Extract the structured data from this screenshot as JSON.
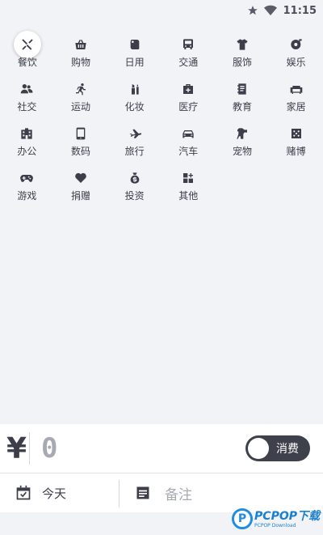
{
  "status_bar": {
    "icons": [
      "star-icon",
      "wifi-icon"
    ],
    "time": "11:15"
  },
  "categories": [
    {
      "label": "餐饮",
      "icon": "fork-knife-icon",
      "selected": true
    },
    {
      "label": "购物",
      "icon": "basket-icon"
    },
    {
      "label": "日用",
      "icon": "toilet-paper-icon"
    },
    {
      "label": "交通",
      "icon": "bus-icon"
    },
    {
      "label": "服饰",
      "icon": "tshirt-icon"
    },
    {
      "label": "娱乐",
      "icon": "music-disc-icon"
    },
    {
      "label": "社交",
      "icon": "people-icon"
    },
    {
      "label": "运动",
      "icon": "runner-icon"
    },
    {
      "label": "化妆",
      "icon": "lipstick-icon"
    },
    {
      "label": "医疗",
      "icon": "medical-kit-icon"
    },
    {
      "label": "教育",
      "icon": "notebook-icon"
    },
    {
      "label": "家居",
      "icon": "sofa-icon"
    },
    {
      "label": "办公",
      "icon": "office-building-icon"
    },
    {
      "label": "数码",
      "icon": "phone-icon"
    },
    {
      "label": "旅行",
      "icon": "airplane-icon"
    },
    {
      "label": "汽车",
      "icon": "car-icon"
    },
    {
      "label": "宠物",
      "icon": "dog-icon"
    },
    {
      "label": "赌博",
      "icon": "dice-icon"
    },
    {
      "label": "游戏",
      "icon": "gamepad-icon"
    },
    {
      "label": "捐赠",
      "icon": "heart-icon"
    },
    {
      "label": "投资",
      "icon": "money-bag-icon"
    },
    {
      "label": "其他",
      "icon": "grid-plus-icon"
    }
  ],
  "amount": {
    "currency_symbol": "¥",
    "value": "0"
  },
  "type_toggle": {
    "label": "消费"
  },
  "date_button": {
    "label": "今天",
    "icon": "calendar-icon"
  },
  "note_field": {
    "placeholder": "备注",
    "icon": "note-icon"
  },
  "watermark": {
    "badge": "P",
    "main": "PCPOP下载",
    "sub": "PCPOP Download"
  },
  "colors": {
    "background": "#f2f3f7",
    "icon": "#3c3f4a",
    "toggle_bg": "#3e414c",
    "placeholder": "#a8aab2",
    "watermark": "#1a7fd0"
  }
}
